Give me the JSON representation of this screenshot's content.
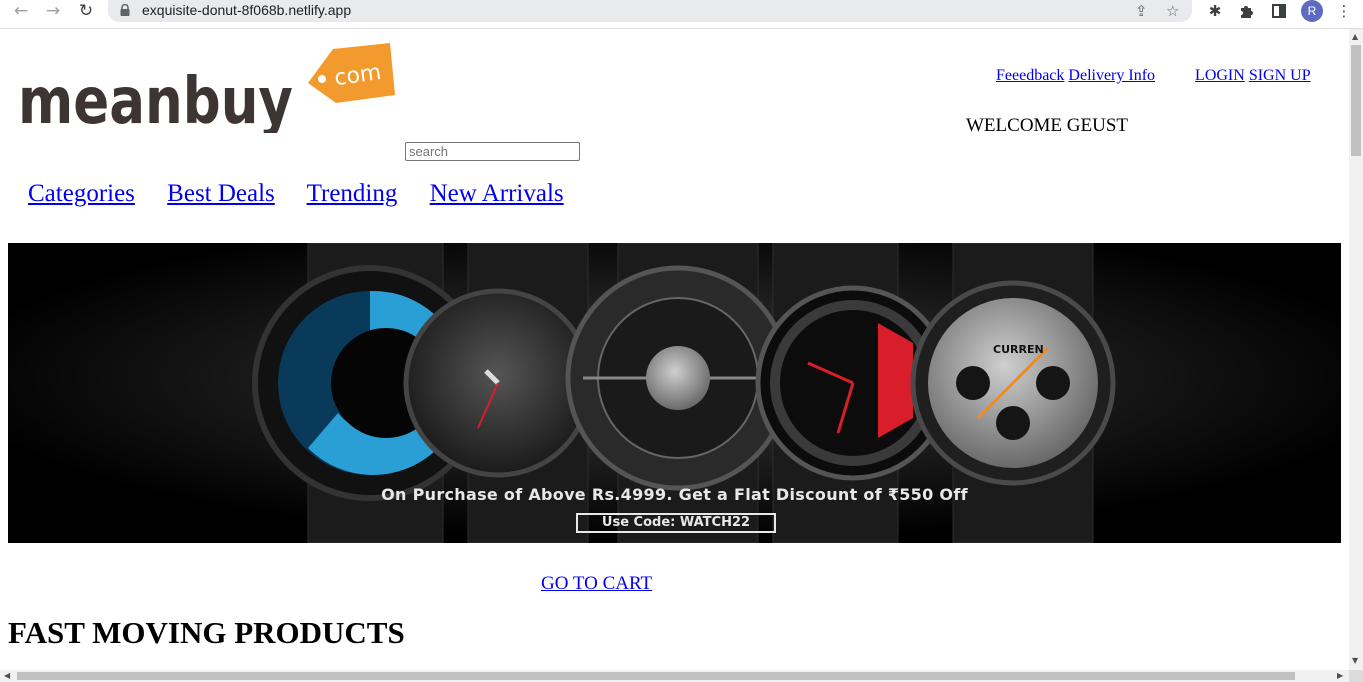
{
  "browser": {
    "url": "exquisite-donut-8f068b.netlify.app",
    "icons": {
      "back": "arrow-left-icon",
      "forward": "arrow-right-icon",
      "reload": "reload-icon",
      "lock": "lock-icon",
      "share": "share-icon",
      "bookmark": "star-icon",
      "extension_bug": "bug-extension-icon",
      "extensions": "puzzle-icon",
      "side_panel": "side-panel-icon",
      "menu": "kebab-menu-icon"
    },
    "profile_initial": "R"
  },
  "header": {
    "logo": {
      "word": "meanbuy",
      "tag": "com"
    },
    "links": {
      "feedback": "Feeedback",
      "delivery": "Delivery Info",
      "login": "LOGIN",
      "signup": "SIGN UP"
    },
    "welcome": "WELCOME GEUST",
    "search": {
      "placeholder": "search",
      "value": ""
    }
  },
  "nav": {
    "items": [
      "Categories",
      "Best Deals",
      "Trending",
      "New Arrivals"
    ]
  },
  "banner": {
    "offer_text": "On Purchase of Above Rs.4999. Get a Flat Discount of ₹550 Off",
    "code_text": "Use Code: WATCH22",
    "brand_on_watch": "CURREN",
    "colors": {
      "background": "#000000",
      "accent_blue": "#2a9fd6",
      "accent_red": "#d81e2a",
      "accent_orange": "#f08a24"
    }
  },
  "cart_link": "GO TO CART",
  "section_title": "FAST MOVING PRODUCTS",
  "colors": {
    "link": "#0000ee",
    "logo_orange": "#f29a2e",
    "logo_text": "#3d3533"
  }
}
